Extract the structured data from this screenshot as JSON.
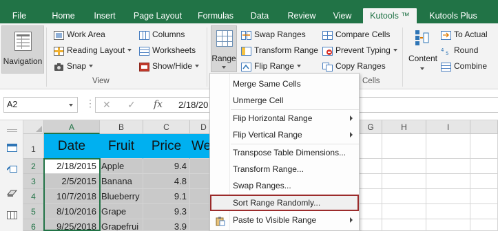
{
  "tabs": [
    "File",
    "Home",
    "Insert",
    "Page Layout",
    "Formulas",
    "Data",
    "Review",
    "View",
    "Kutools ™",
    "Kutools Plus"
  ],
  "active_tab": "Kutools ™",
  "ribbon": {
    "navigation": "Navigation",
    "view_group": {
      "work_area": "Work Area",
      "reading_layout": "Reading Layout",
      "snap": "Snap",
      "columns": "Columns",
      "worksheets": "Worksheets",
      "show_hide": "Show/Hide",
      "label": "View"
    },
    "range_group": {
      "range": "Range",
      "swap_ranges": "Swap Ranges",
      "transform_range": "Transform Range",
      "flip_range": "Flip Range",
      "compare_cells": "Compare Cells",
      "prevent_typing": "Prevent Typing",
      "copy_ranges": "Copy Ranges",
      "label": "Cells"
    },
    "content_group": {
      "content": "Content",
      "to_actual": "To Actual",
      "round": "Round",
      "combine": "Combine"
    }
  },
  "formula_bar": {
    "name_box": "A2",
    "cancel": "✕",
    "enter": "✓",
    "fx": "fx",
    "value": "2/18/20"
  },
  "grid": {
    "columns": [
      "A",
      "B",
      "C",
      "D",
      "E",
      "F",
      "G",
      "H",
      "I"
    ],
    "row_numbers": [
      "1",
      "2",
      "3",
      "4",
      "5",
      "6"
    ],
    "header_row": [
      "Date",
      "Fruit",
      "Price",
      "We"
    ],
    "rows": [
      [
        "2/18/2015",
        "Apple",
        "9.4"
      ],
      [
        "2/5/2015",
        "Banana",
        "4.8"
      ],
      [
        "10/7/2018",
        "Blueberry",
        "9.1"
      ],
      [
        "8/10/2016",
        "Grape",
        "9.3"
      ],
      [
        "9/25/2018",
        "Grapefrui",
        "3.9"
      ]
    ]
  },
  "context_menu": {
    "items": [
      {
        "label": "Merge Same Cells",
        "submenu": false
      },
      {
        "label": "Unmerge Cell",
        "submenu": false
      },
      {
        "label": "Flip Horizontal Range",
        "submenu": true
      },
      {
        "label": "Flip Vertical Range",
        "submenu": true
      },
      {
        "label": "Transpose Table Dimensions...",
        "submenu": false
      },
      {
        "label": "Transform Range...",
        "submenu": false
      },
      {
        "label": "Swap Ranges...",
        "submenu": false
      },
      {
        "label": "Sort Range Randomly...",
        "submenu": false
      },
      {
        "label": "Paste to Visible Range",
        "submenu": true
      }
    ],
    "highlighted_item": "Sort Range Randomly..."
  },
  "colors": {
    "excel_green": "#217346",
    "header_fill": "#00b0f0",
    "data_fill": "#c9c9c9",
    "highlight_border": "#9b2b2b"
  }
}
